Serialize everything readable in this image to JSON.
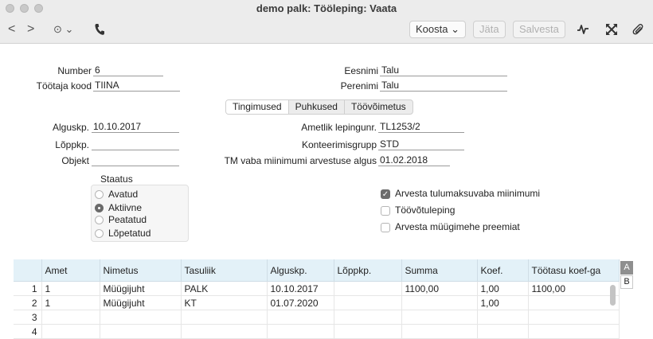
{
  "window": {
    "title": "demo palk: Tööleping: Vaata"
  },
  "toolbar": {
    "back_glyph": "<",
    "forward_glyph": ">",
    "more_glyph": "⊙ ⌄",
    "phone_icon": "phone-icon",
    "koosta_label": "Koosta ⌄",
    "jata_label": "Jäta",
    "salvesta_label": "Salvesta",
    "icons": [
      "activity-icon",
      "expand-icon",
      "paperclip-icon"
    ]
  },
  "form": {
    "number_label": "Number",
    "number_value": "6",
    "tootaja_label": "Töötaja kood",
    "tootaja_value": "TIINA",
    "eesnimi_label": "Eesnimi",
    "eesnimi_value": "Talu",
    "perenimi_label": "Perenimi",
    "perenimi_value": "Talu",
    "tabs": [
      "Tingimused",
      "Puhkused",
      "Töövõimetus"
    ],
    "alguskp_label": "Alguskp.",
    "alguskp_value": "10.10.2017",
    "loppkp_label": "Lõppkp.",
    "loppkp_value": "",
    "objekt_label": "Objekt",
    "objekt_value": "",
    "ametlik_label": "Ametlik lepingunr.",
    "ametlik_value": "TL1253/2",
    "konteerimis_label": "Konteerimisgrupp",
    "konteerimis_value": "STD",
    "tm_label": "TM vaba miinimumi arvestuse algus",
    "tm_value": "01.02.2018",
    "staatus_label": "Staatus",
    "staatus_options": [
      "Avatud",
      "Aktiivne",
      "Peatatud",
      "Lõpetatud"
    ],
    "staatus_selected": "Aktiivne",
    "checkboxes": [
      {
        "label": "Arvesta tulumaksuvaba miinimumi",
        "checked": true
      },
      {
        "label": "Töövõtuleping",
        "checked": false
      },
      {
        "label": "Arvesta müügimehe preemiat",
        "checked": false
      }
    ]
  },
  "table": {
    "columns": [
      "",
      "Amet",
      "Nimetus",
      "Tasuliik",
      "Alguskp.",
      "Lõppkp.",
      "Summa",
      "Koef.",
      "Töötasu koef-ga"
    ],
    "rows": [
      [
        "1",
        "1",
        "Müügijuht",
        "PALK",
        "10.10.2017",
        "",
        "1100,00",
        "1,00",
        "1100,00"
      ],
      [
        "2",
        "1",
        "Müügijuht",
        "KT",
        "01.07.2020",
        "",
        "",
        "1,00",
        ""
      ],
      [
        "3",
        "",
        "",
        "",
        "",
        "",
        "",
        "",
        ""
      ],
      [
        "4",
        "",
        "",
        "",
        "",
        "",
        "",
        "",
        ""
      ]
    ],
    "side_tabs": [
      "A",
      "B"
    ]
  }
}
